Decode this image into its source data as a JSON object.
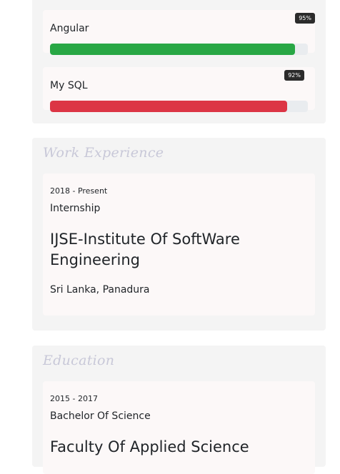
{
  "skills": [
    {
      "name": "Angular",
      "percent_label": "95%",
      "level": 0.95,
      "color": "#28a745"
    },
    {
      "name": "My SQL",
      "percent_label": "92%",
      "level": 0.92,
      "color": "#dc3545"
    }
  ],
  "work": {
    "title": "Work Experience",
    "entries": [
      {
        "period": "2018 - Present",
        "role": "Internship",
        "organization": "IJSE-Institute Of SoftWare Engineering",
        "location": "Sri Lanka, Panadura"
      }
    ]
  },
  "education": {
    "title": "Education",
    "entries": [
      {
        "period": "2015 - 2017",
        "degree": "Bachelor Of Science",
        "organization": "Faculty Of Applied Science"
      }
    ]
  }
}
